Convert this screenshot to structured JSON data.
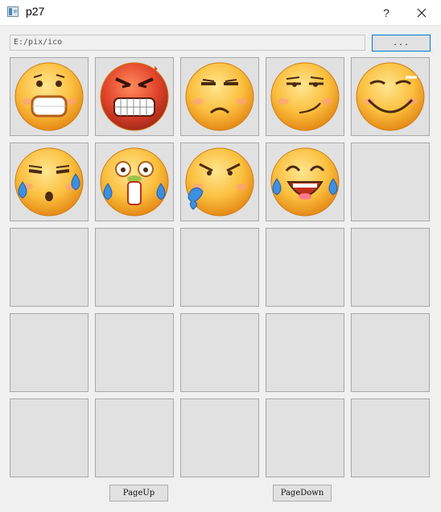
{
  "window": {
    "title": "p27",
    "help_label": "?",
    "close_icon": "close-icon"
  },
  "toolbar": {
    "path_value": "E:/pix/ico",
    "browse_label": "..."
  },
  "grid": {
    "rows": 5,
    "columns": 5,
    "cells": [
      {
        "icon": "scared-face-icon",
        "filled": true
      },
      {
        "icon": "angry-face-icon",
        "filled": true
      },
      {
        "icon": "sad-face-icon",
        "filled": true
      },
      {
        "icon": "smug-face-icon",
        "filled": true
      },
      {
        "icon": "grin-face-icon",
        "filled": true
      },
      {
        "icon": "sweating-face-icon",
        "filled": true
      },
      {
        "icon": "crying-face-icon",
        "filled": true
      },
      {
        "icon": "puffing-face-icon",
        "filled": true
      },
      {
        "icon": "tears-of-joy-face-icon",
        "filled": true
      },
      {
        "filled": false
      },
      {
        "filled": false
      },
      {
        "filled": false
      },
      {
        "filled": false
      },
      {
        "filled": false
      },
      {
        "filled": false
      },
      {
        "filled": false
      },
      {
        "filled": false
      },
      {
        "filled": false
      },
      {
        "filled": false
      },
      {
        "filled": false
      },
      {
        "filled": false
      },
      {
        "filled": false
      },
      {
        "filled": false
      },
      {
        "filled": false
      },
      {
        "filled": false
      }
    ]
  },
  "pager": {
    "page_up_label": "PageUp",
    "page_down_label": "PageDown"
  },
  "colors": {
    "focus_border": "#0078d7",
    "face_yellow": "#f9b93a",
    "face_red": "#e2452b",
    "tear_blue": "#3d8fe0"
  }
}
